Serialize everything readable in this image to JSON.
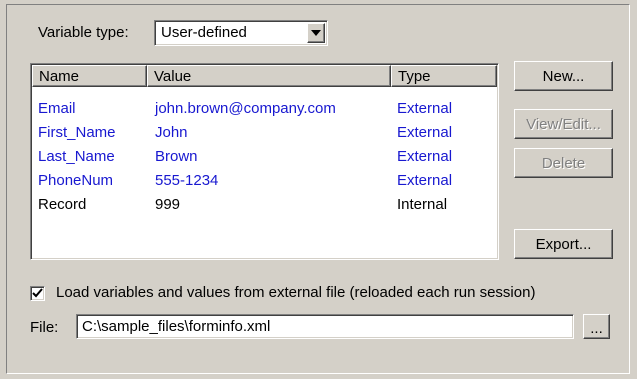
{
  "variable_type": {
    "label": "Variable type:",
    "value": "User-defined"
  },
  "table": {
    "columns": [
      "Name",
      "Value",
      "Type"
    ],
    "rows": [
      {
        "name": "Email",
        "value": "john.brown@company.com",
        "type": "External"
      },
      {
        "name": "First_Name",
        "value": "John",
        "type": "External"
      },
      {
        "name": "Last_Name",
        "value": "Brown",
        "type": "External"
      },
      {
        "name": "PhoneNum",
        "value": "555-1234",
        "type": "External"
      },
      {
        "name": "Record",
        "value": "999",
        "type": "Internal"
      }
    ]
  },
  "buttons": {
    "new": "New...",
    "view_edit": "View/Edit...",
    "delete": "Delete",
    "export": "Export...",
    "browse": "..."
  },
  "load_option": {
    "label": "Load variables and values from external file (reloaded each run session)",
    "checked": true
  },
  "file": {
    "label": "File:",
    "value": "C:\\sample_files\\forminfo.xml"
  },
  "colors": {
    "external_text": "#1818d0",
    "internal_text": "#000000",
    "background": "#d4d0c8"
  }
}
